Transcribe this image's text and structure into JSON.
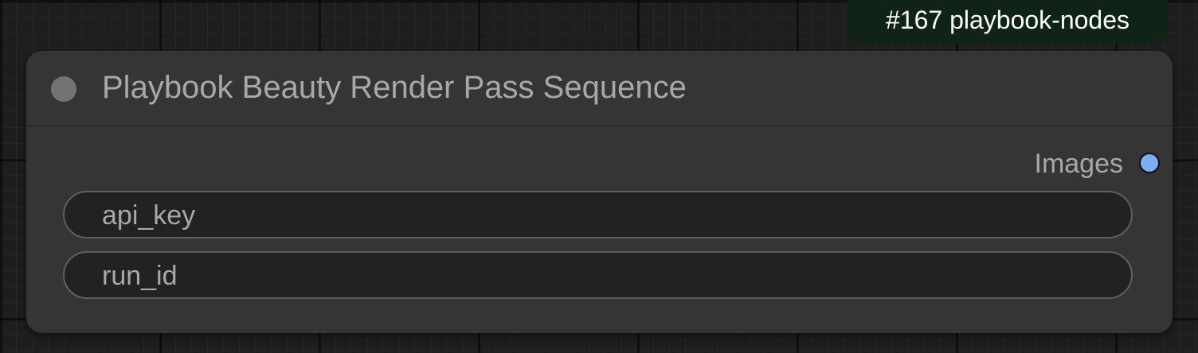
{
  "badge": {
    "text": "#167 playbook-nodes"
  },
  "node": {
    "title": "Playbook Beauty Render Pass Sequence",
    "outputs": [
      {
        "label": "Images",
        "slot_color": "#7ab0f2"
      }
    ],
    "widgets": [
      {
        "label": "api_key"
      },
      {
        "label": "run_id"
      }
    ]
  },
  "colors": {
    "canvas_background": "#1e1e1e",
    "node_body": "#353535",
    "badge_background": "#0f2416",
    "widget_background": "#222222",
    "text": "#a8a8a8"
  },
  "icons": {
    "collapse_dot": "circle-icon",
    "output_slot": "connection-dot-icon"
  }
}
